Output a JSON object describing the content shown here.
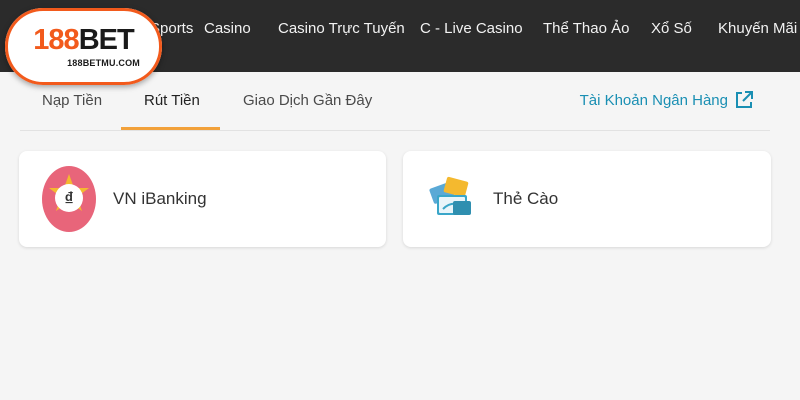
{
  "header": {
    "logo": {
      "brand_number": "188",
      "brand_word": "BET",
      "tagline": "188BETMU.COM"
    },
    "nav": [
      {
        "label": "Sports"
      },
      {
        "label": "Casino"
      },
      {
        "label": "Casino Trực Tuyến"
      },
      {
        "label": "C - Live Casino"
      },
      {
        "label": "Thể Thao Ảo"
      },
      {
        "label": "Xổ Số"
      },
      {
        "label": "Khuyến Mãi"
      }
    ]
  },
  "tabs": [
    {
      "label": "Nạp Tiền"
    },
    {
      "label": "Rút Tiền",
      "active": true
    },
    {
      "label": "Giao Dịch Gần Đây"
    }
  ],
  "bank_account_link": {
    "label": "Tài Khoản Ngân Hàng",
    "icon": "external-link-icon"
  },
  "methods": [
    {
      "label": "VN iBanking",
      "icon": "dong-coin-icon"
    },
    {
      "label": "Thẻ Cào",
      "icon": "scratch-card-icon"
    }
  ],
  "colors": {
    "header_bg": "#2b2b2b",
    "brand_orange": "#f25a1c",
    "active_underline": "#f2a13a",
    "link_blue": "#1a8fb3",
    "page_bg": "#f5f5f5"
  }
}
